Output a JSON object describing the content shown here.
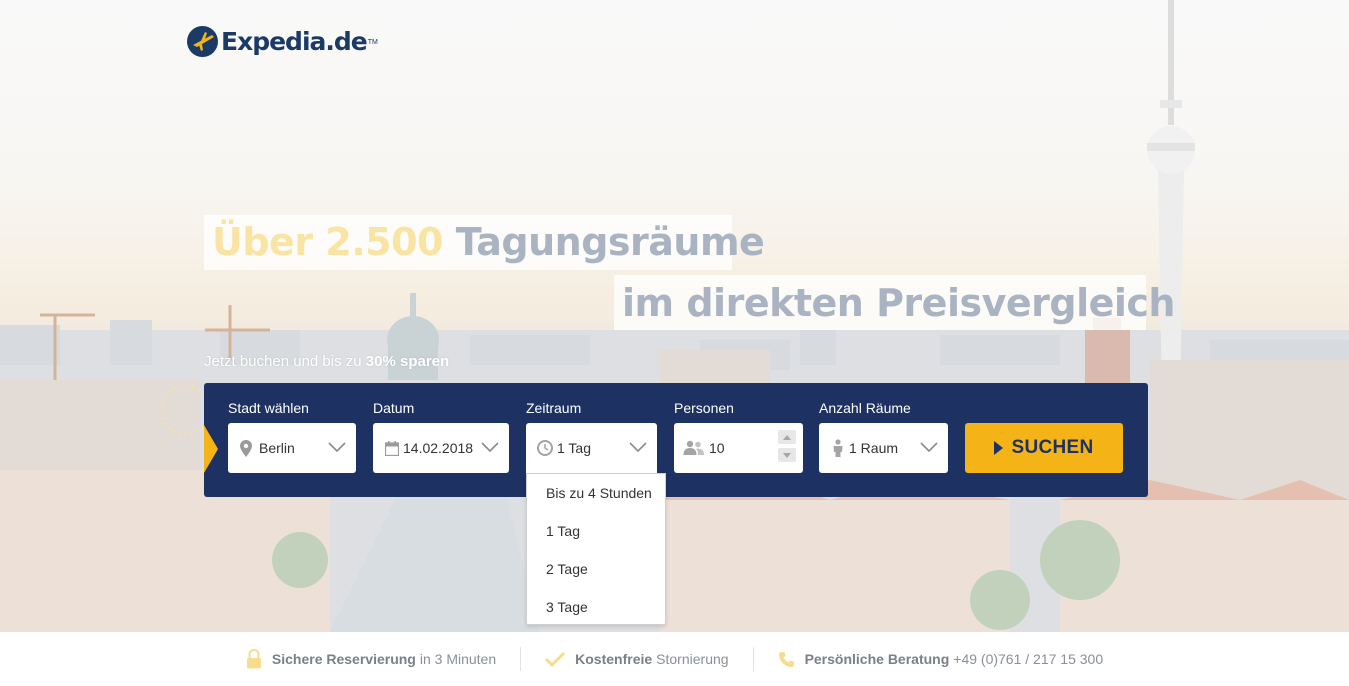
{
  "logo": {
    "text": "Expedia.de",
    "tm": "TM"
  },
  "hero": {
    "headline_accent": "Über 2.500",
    "headline_main": "Tagungsräume",
    "headline_line2": "im direkten Preisvergleich",
    "sub_prefix": "Jetzt buchen und bis zu",
    "sub_bold": "30% sparen"
  },
  "search": {
    "city": {
      "label": "Stadt wählen",
      "value": "Berlin",
      "icon": "map-pin-icon"
    },
    "date": {
      "label": "Datum",
      "value": "14.02.2018",
      "icon": "calendar-icon"
    },
    "duration": {
      "label": "Zeitraum",
      "value": "1 Tag",
      "icon": "clock-icon",
      "options": [
        "Bis zu 4 Stunden",
        "1 Tag",
        "2 Tage",
        "3 Tage"
      ]
    },
    "persons": {
      "label": "Personen",
      "value": "10",
      "icon": "people-icon"
    },
    "rooms": {
      "label": "Anzahl Räume",
      "value": "1 Raum",
      "icon": "person-icon"
    },
    "button": "SUCHEN"
  },
  "trust": [
    {
      "bold": "Sichere Reservierung",
      "text": "in 3 Minuten",
      "icon": "lock-icon"
    },
    {
      "bold": "Kostenfreie",
      "text": "Stornierung",
      "icon": "checkmark-icon"
    },
    {
      "bold": "Persönliche Beratung",
      "text": "+49 (0)761 / 217 15 300",
      "icon": "phone-icon"
    }
  ],
  "colors": {
    "navy": "#1d3262",
    "accent": "#f4b417",
    "headline_accent": "#f9e4a4",
    "headline_main": "#aab3c1"
  }
}
